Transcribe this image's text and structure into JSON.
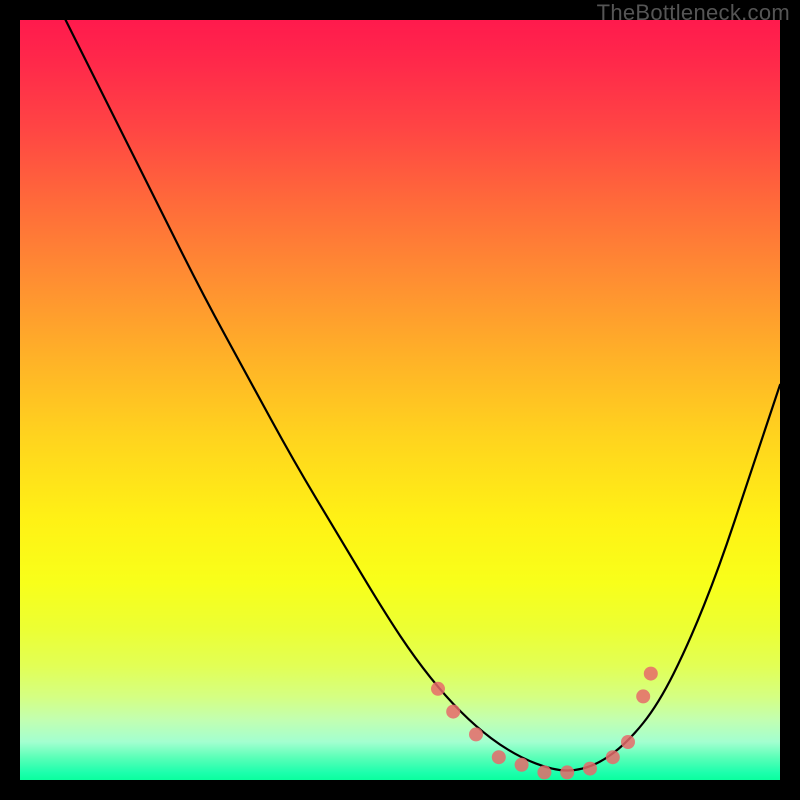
{
  "watermark": "TheBottleneck.com",
  "chart_data": {
    "type": "line",
    "title": "",
    "xlabel": "",
    "ylabel": "",
    "xlim": [
      0,
      100
    ],
    "ylim": [
      0,
      100
    ],
    "grid": false,
    "legend": false,
    "series": [
      {
        "name": "curve",
        "color": "#000000",
        "x": [
          6,
          12,
          18,
          24,
          30,
          36,
          42,
          48,
          52,
          56,
          60,
          64,
          68,
          72,
          76,
          80,
          84,
          88,
          92,
          96,
          100
        ],
        "y": [
          100,
          88,
          76,
          64,
          53,
          42,
          32,
          22,
          16,
          11,
          7,
          4,
          2,
          1,
          2,
          5,
          10,
          18,
          28,
          40,
          52
        ]
      }
    ],
    "markers": [
      {
        "x": 55,
        "y": 12
      },
      {
        "x": 57,
        "y": 9
      },
      {
        "x": 60,
        "y": 6
      },
      {
        "x": 63,
        "y": 3
      },
      {
        "x": 66,
        "y": 2
      },
      {
        "x": 69,
        "y": 1
      },
      {
        "x": 72,
        "y": 1
      },
      {
        "x": 75,
        "y": 1.5
      },
      {
        "x": 78,
        "y": 3
      },
      {
        "x": 80,
        "y": 5
      },
      {
        "x": 82,
        "y": 11
      },
      {
        "x": 83,
        "y": 14
      }
    ],
    "marker_color": "#e66a6a",
    "gradient_stops": [
      {
        "pos": 0,
        "color": "#ff1a4d"
      },
      {
        "pos": 50,
        "color": "#ffe31a"
      },
      {
        "pos": 100,
        "color": "#0aff9e"
      }
    ]
  }
}
